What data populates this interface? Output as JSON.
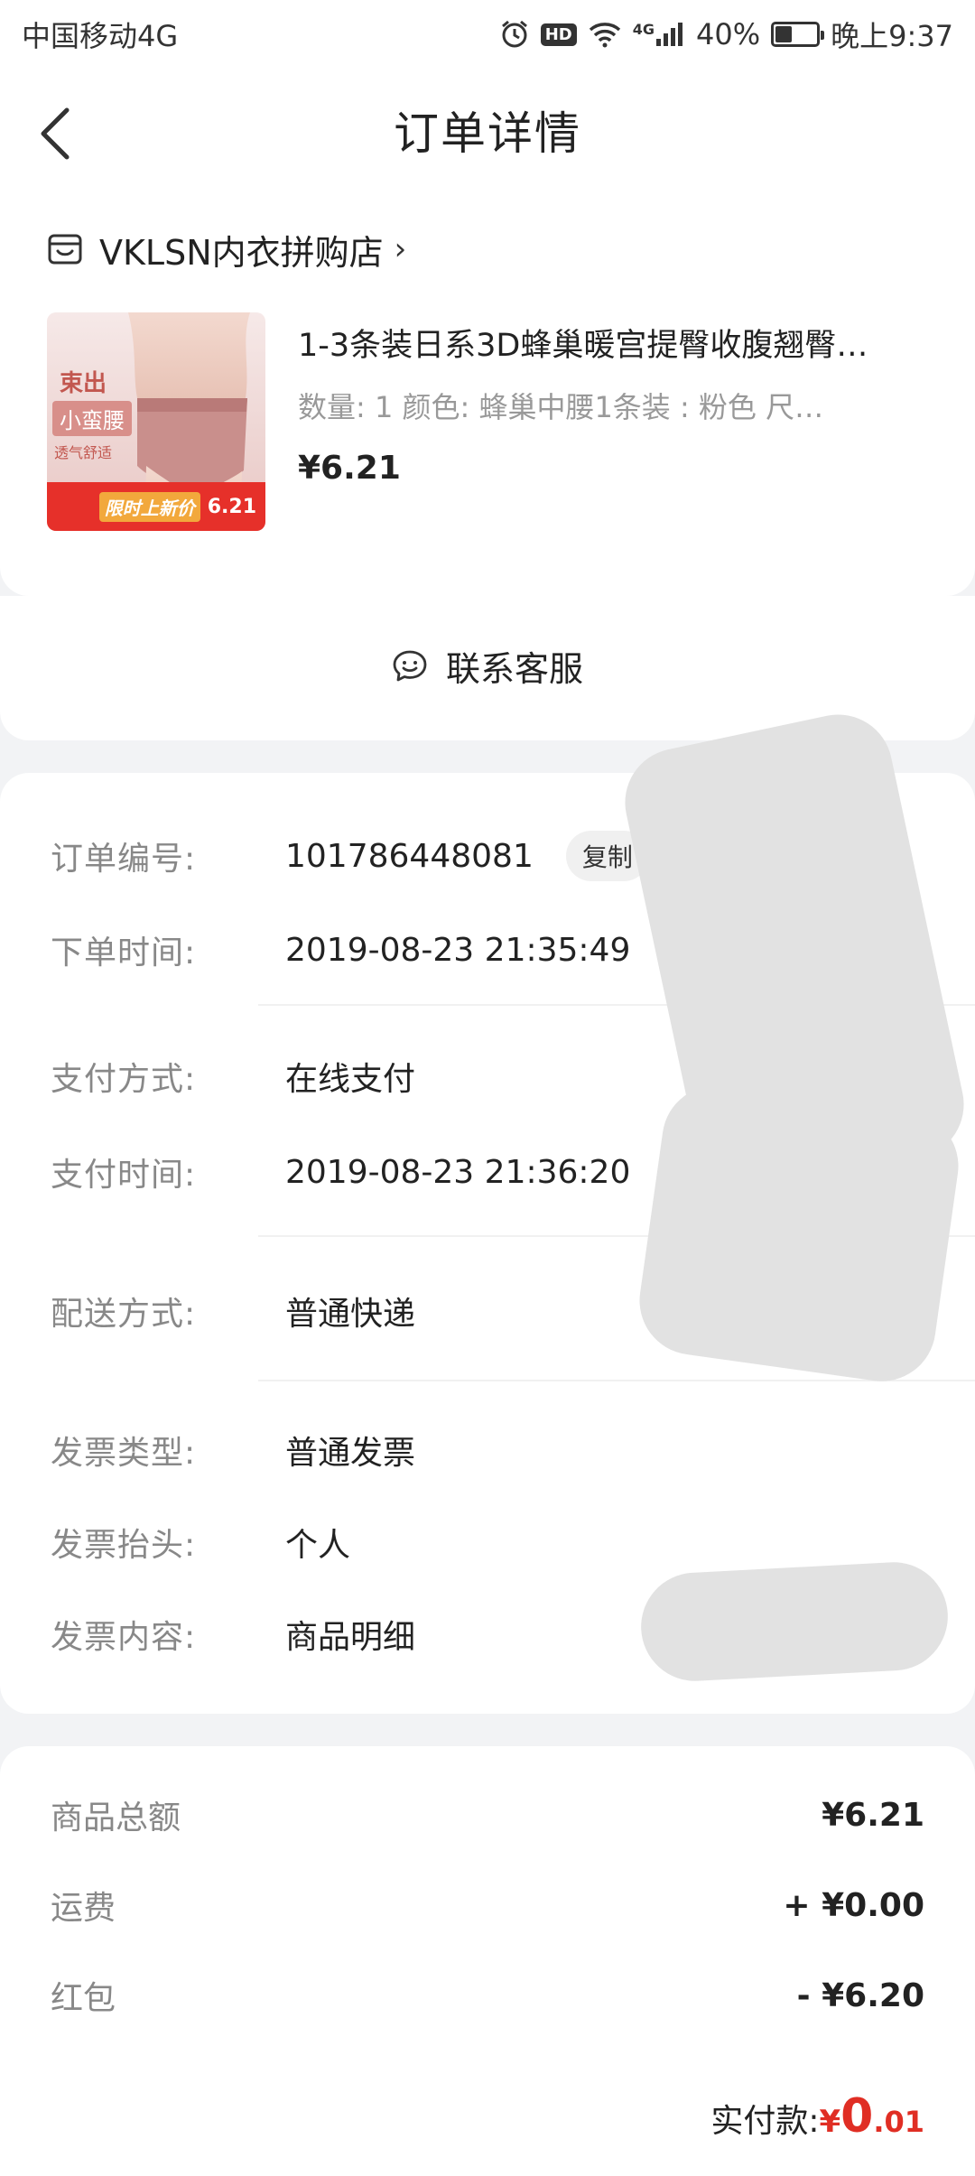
{
  "status_bar": {
    "carrier": "中国移动4G",
    "hd": "HD",
    "network": "4G",
    "battery": "40%",
    "battery_level": 0.4,
    "time": "晚上9:37"
  },
  "nav": {
    "title": "订单详情",
    "back_icon": "chevron-left-icon"
  },
  "shop": {
    "name": "VKLSN内衣拼购店",
    "arrow": "›",
    "icon": "store-icon"
  },
  "product": {
    "title": "1-3条装日系3D蜂巢暖宫提臀收腹翘臀…",
    "spec": "数量: 1   颜色: 蜂巢中腰1条装 : 粉色   尺…",
    "price": "¥6.21",
    "image_text": {
      "line1": "束出",
      "line2": "小蛮腰",
      "line3": "透气舒适",
      "banner": "限时上新价",
      "banner_price": "6.21"
    }
  },
  "customer_service": {
    "label": "联系客服",
    "icon": "chat-smile-icon"
  },
  "order_info": {
    "order_no_label": "订单编号:",
    "order_no": "101786448081",
    "copy": "复制",
    "order_time_label": "下单时间:",
    "order_time": "2019-08-23 21:35:49",
    "pay_method_label": "支付方式:",
    "pay_method": "在线支付",
    "pay_time_label": "支付时间:",
    "pay_time": "2019-08-23 21:36:20",
    "delivery_label": "配送方式:",
    "delivery": "普通快递",
    "invoice_type_label": "发票类型:",
    "invoice_type": "普通发票",
    "invoice_title_label": "发票抬头:",
    "invoice_title": "个人",
    "invoice_content_label": "发票内容:",
    "invoice_content": "商品明细"
  },
  "price_summary": {
    "goods_total_label": "商品总额",
    "goods_total": "¥6.21",
    "shipping_label": "运费",
    "shipping": "+ ¥0.00",
    "red_packet_label": "红包",
    "red_packet": "- ¥6.20",
    "paid_label": "实付款:",
    "paid_symbol": "¥",
    "paid_int": "0",
    "paid_dec": ".01"
  },
  "colors": {
    "accent_red": "#e02e24",
    "background": "#f2f3f5"
  }
}
